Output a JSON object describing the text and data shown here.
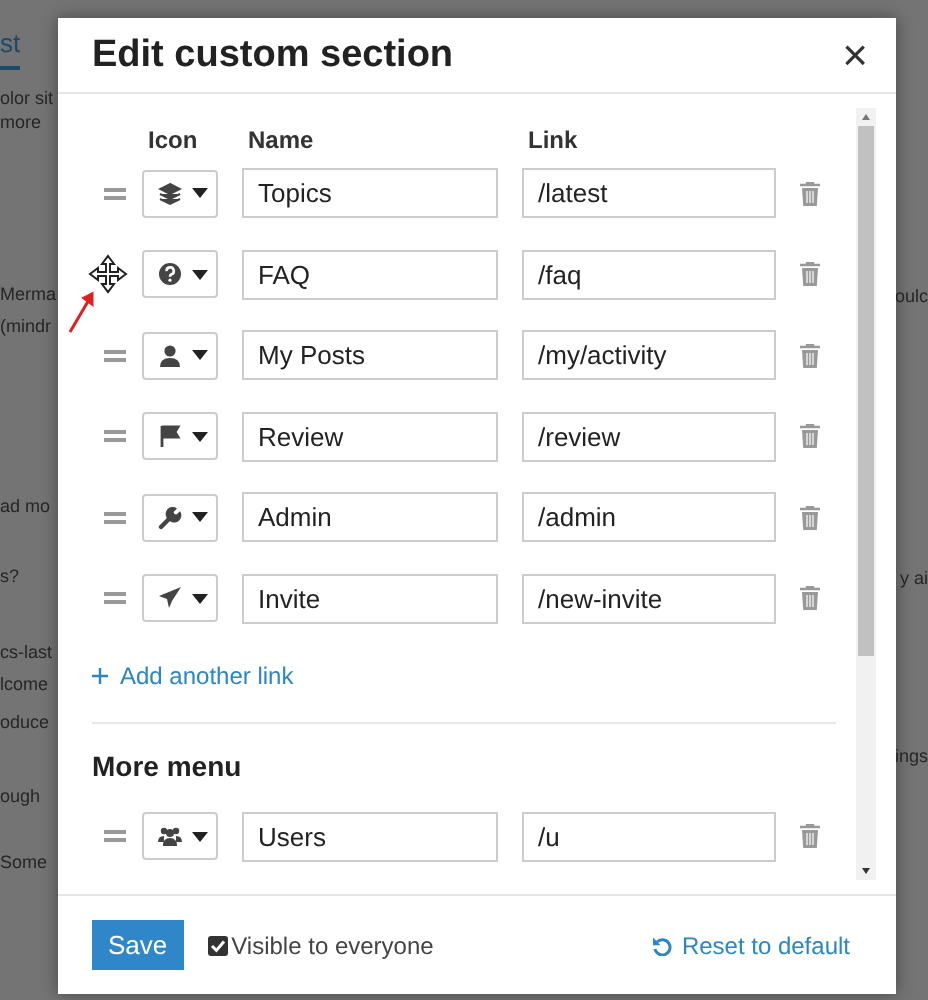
{
  "background": {
    "tab": "st",
    "left_fragments": [
      "olor sit",
      "more",
      "Merma",
      "(mindr",
      "ad mo",
      "s?",
      "cs-last",
      "lcome",
      "oduce",
      "ough",
      "Some"
    ],
    "right_fragments": [
      "oulc",
      "y ai",
      "ings"
    ]
  },
  "dialog": {
    "title": "Edit custom section",
    "close": "×"
  },
  "columns": [
    "Icon",
    "Name",
    "Link"
  ],
  "links": [
    {
      "kind": "layers",
      "name": "Topics",
      "link": "/latest",
      "grabbed": false
    },
    {
      "kind": "question",
      "name": "FAQ",
      "link": "/faq",
      "grabbed": true
    },
    {
      "kind": "user",
      "name": "My Posts",
      "link": "/my/activity",
      "grabbed": false
    },
    {
      "kind": "flag",
      "name": "Review",
      "link": "/review",
      "grabbed": false
    },
    {
      "kind": "wrench",
      "name": "Admin",
      "link": "/admin",
      "grabbed": false
    },
    {
      "kind": "plane",
      "name": "Invite",
      "link": "/new-invite",
      "grabbed": false
    }
  ],
  "add_link": "Add another link",
  "more_menu": {
    "title": "More menu",
    "links": [
      {
        "kind": "users",
        "name": "Users",
        "link": "/u",
        "grabbed": false
      }
    ]
  },
  "footer": {
    "save": "Save",
    "visible": {
      "label": "Visible to everyone",
      "checked": true
    },
    "reset": "Reset to default"
  }
}
